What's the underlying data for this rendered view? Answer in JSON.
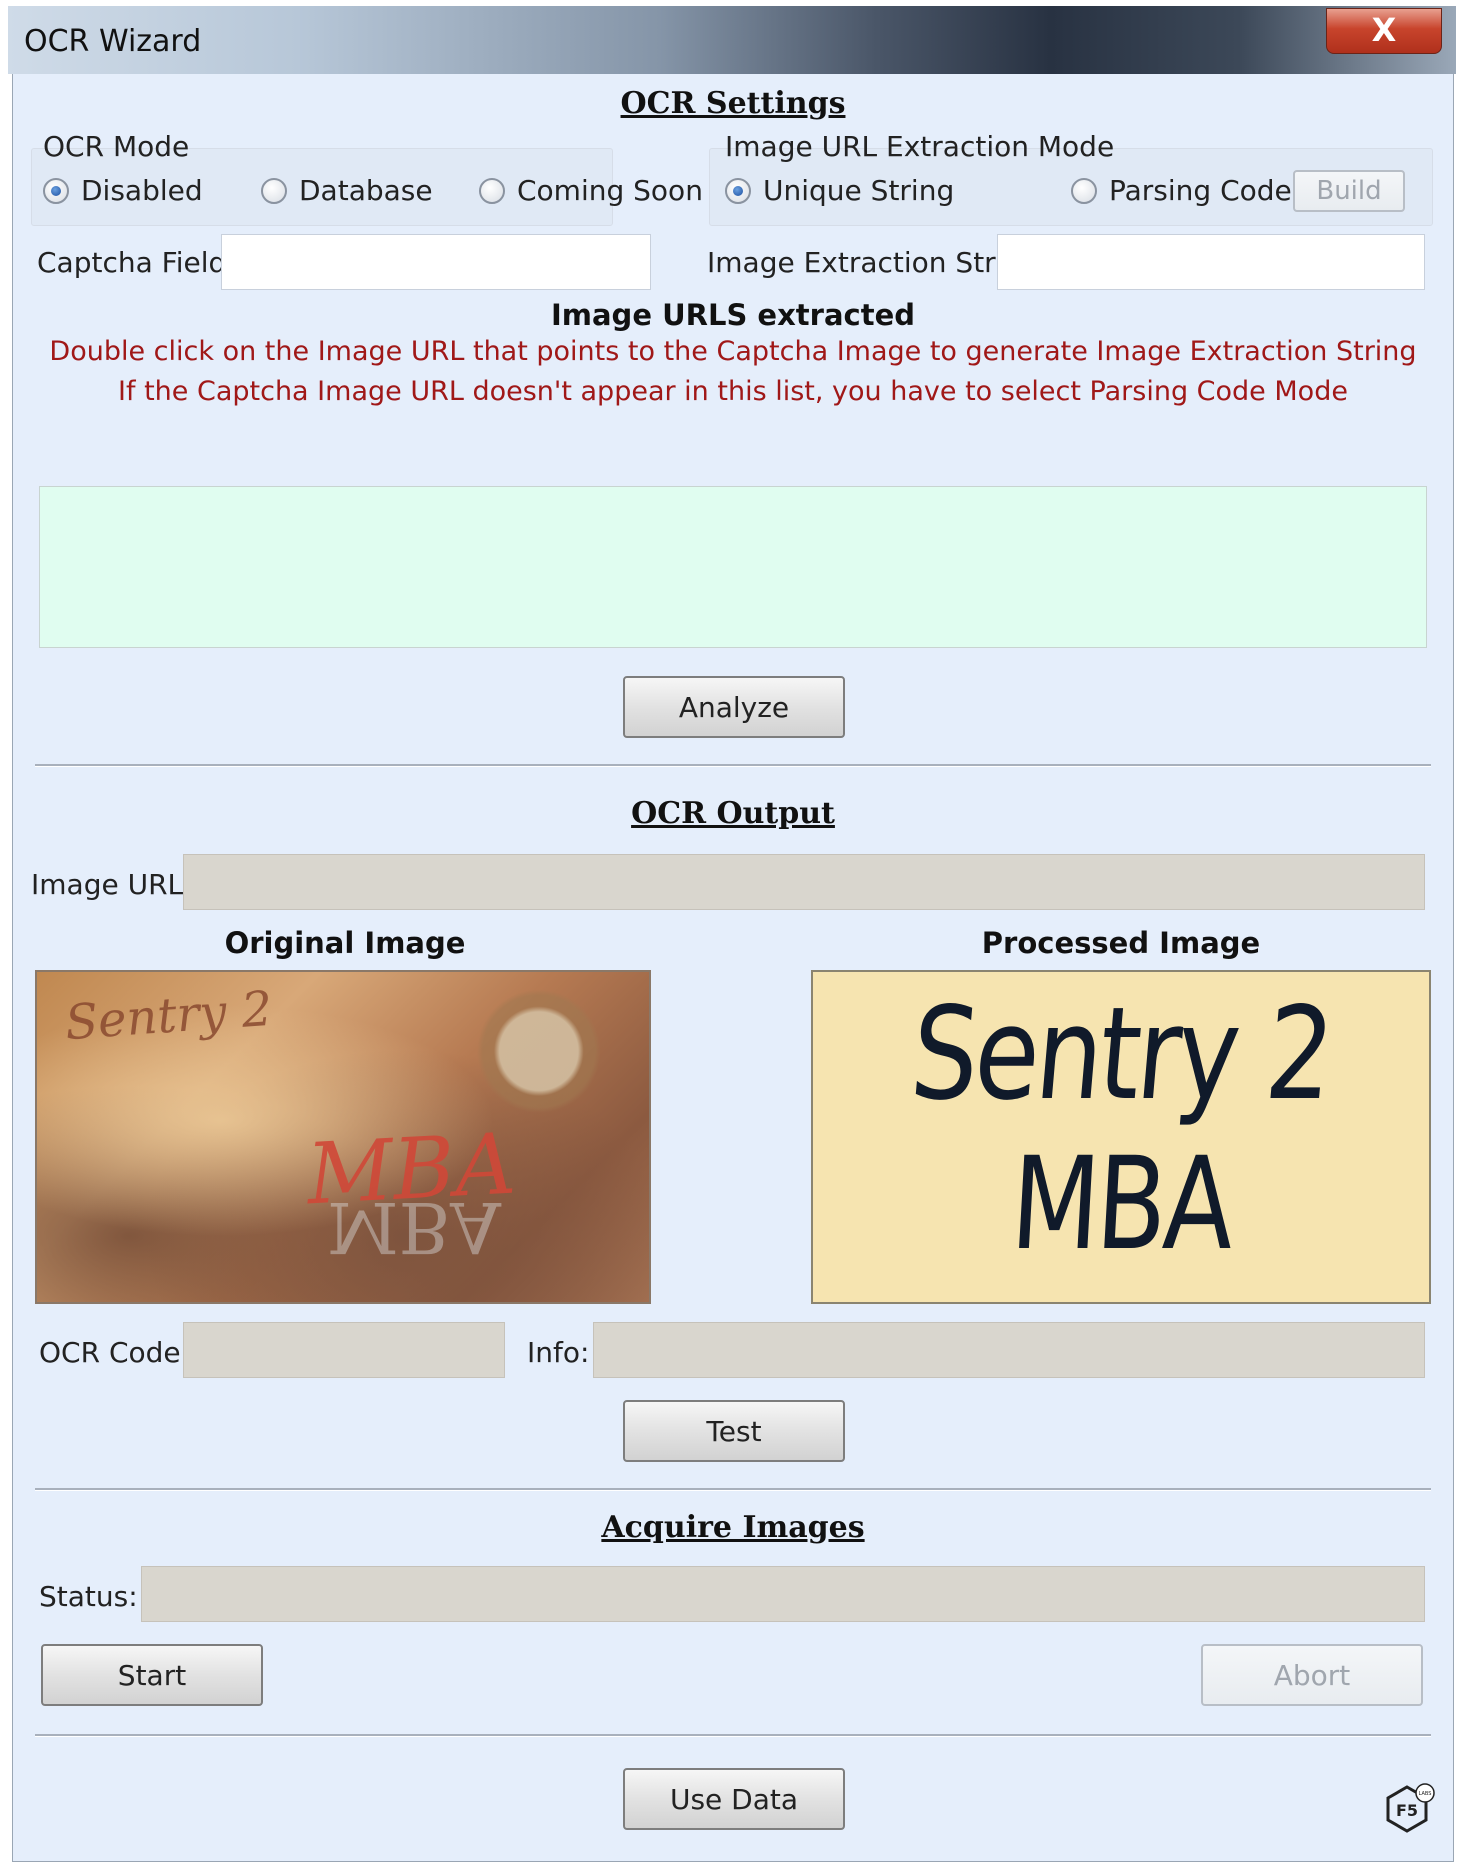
{
  "window": {
    "title": "OCR Wizard",
    "close_glyph": "X"
  },
  "ocr_settings": {
    "heading": "OCR Settings",
    "ocr_mode": {
      "label": "OCR Mode",
      "options": [
        {
          "label": "Disabled",
          "selected": true
        },
        {
          "label": "Database",
          "selected": false
        },
        {
          "label": "Coming Soon",
          "selected": false
        }
      ]
    },
    "url_mode": {
      "label": "Image URL Extraction Mode",
      "options": [
        {
          "label": "Unique String",
          "selected": true
        },
        {
          "label": "Parsing Code",
          "selected": false
        }
      ],
      "build_label": "Build"
    },
    "captcha_field_label": "Captcha Field:",
    "captcha_field_value": "",
    "extraction_string_label": "Image Extraction String:",
    "extraction_string_value": "",
    "urls_heading": "Image URLS extracted",
    "instruction_1": "Double click on the Image URL that points to the Captcha Image to generate Image Extraction String",
    "instruction_2": "If the Captcha Image URL doesn't appear in this list, you have to select Parsing Code Mode",
    "analyze_label": "Analyze"
  },
  "ocr_output": {
    "heading": "OCR Output",
    "image_url_label": "Image URL:",
    "image_url_value": "",
    "original_image_label": "Original Image",
    "processed_image_label": "Processed Image",
    "original_image_text": [
      "Sentry 2",
      "MBA",
      "MBA"
    ],
    "processed_image_text": [
      "Sentry 2",
      "MBA"
    ],
    "ocr_code_label": "OCR Code:",
    "ocr_code_value": "",
    "info_label": "Info:",
    "info_value": "",
    "test_label": "Test"
  },
  "acquire_images": {
    "heading": "Acquire Images",
    "status_label": "Status:",
    "status_value": "",
    "start_label": "Start",
    "abort_label": "Abort"
  },
  "use_data_label": "Use Data",
  "logo_text": "F5",
  "logo_badge": "LABS",
  "colors": {
    "instruction_red": "#a01818",
    "list_bg": "#e0fdf0",
    "client_bg": "#e5eefb",
    "processed_bg": "#f6e4b0"
  }
}
